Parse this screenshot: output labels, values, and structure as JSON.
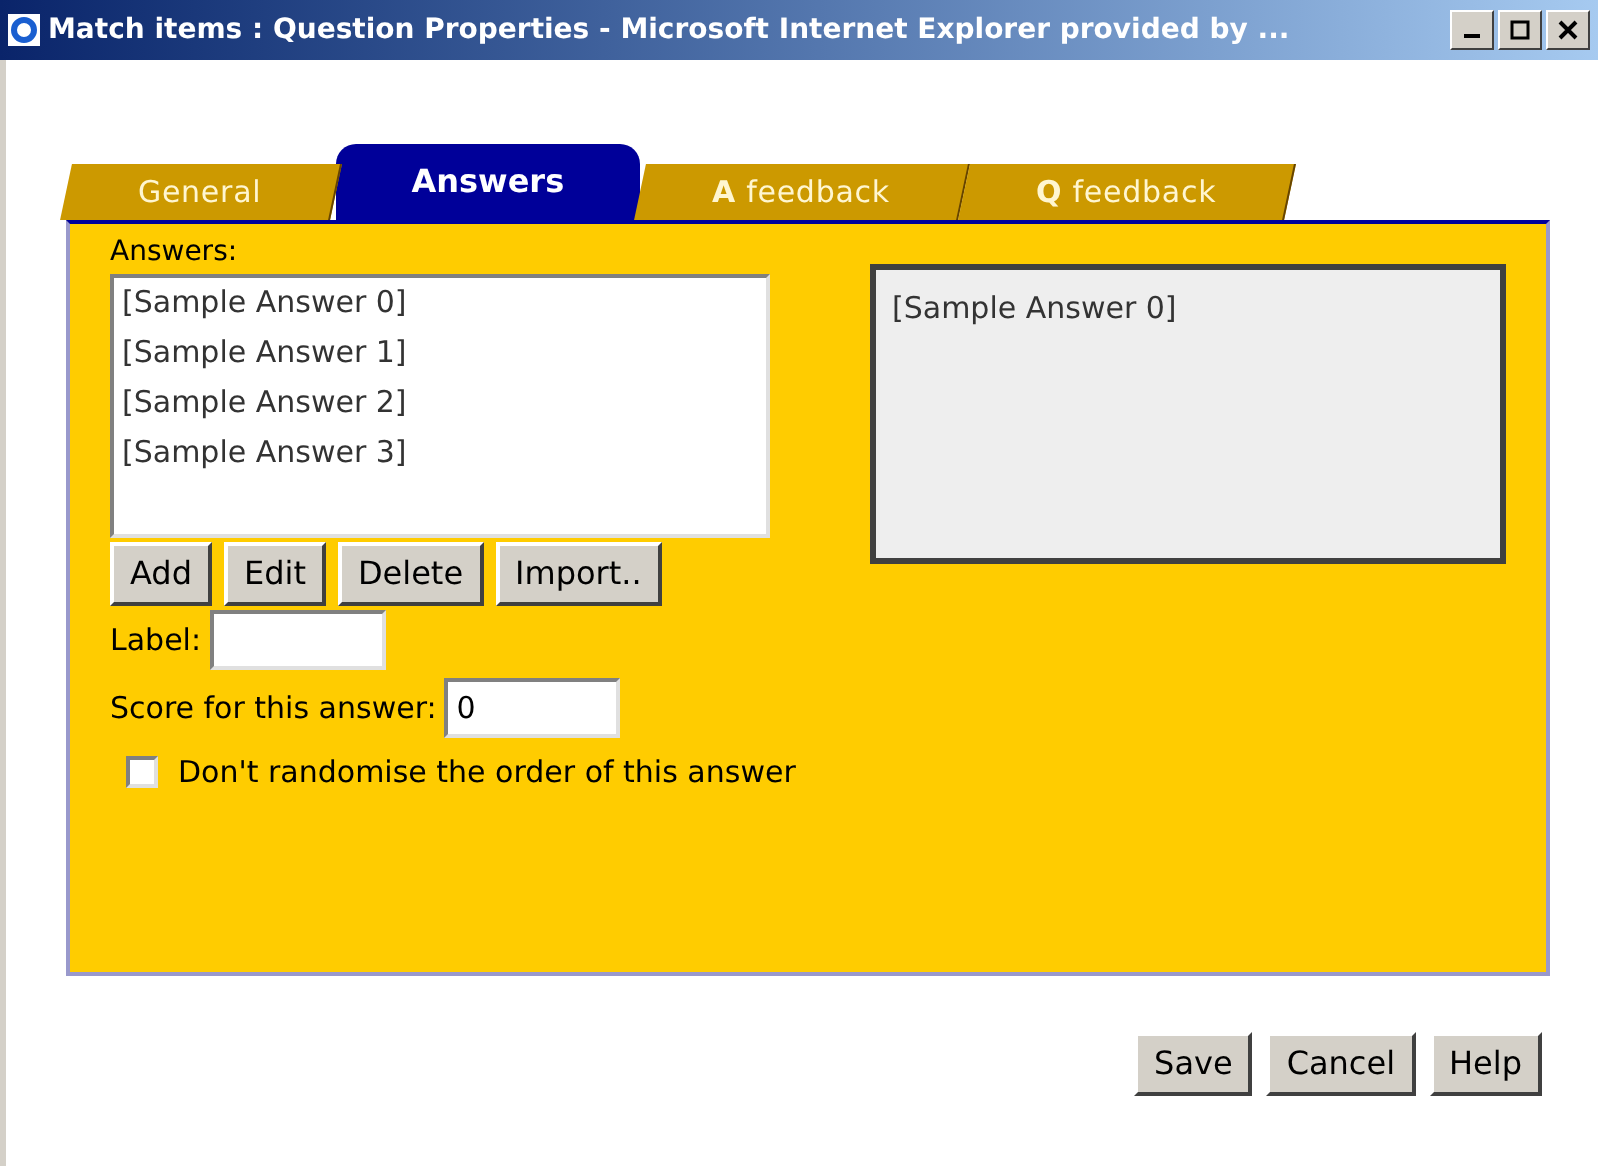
{
  "window": {
    "title": "Match items : Question Properties - Microsoft Internet Explorer provided by ..."
  },
  "tabs": [
    {
      "label": "General",
      "selected": false
    },
    {
      "label": "Answers",
      "selected": true
    },
    {
      "label": "**A** feedback",
      "selected": false
    },
    {
      "label": "**Q** feedback",
      "selected": false
    }
  ],
  "answers": {
    "label": "Answers:",
    "items": [
      "[Sample Answer 0]",
      "[Sample Answer 1]",
      "[Sample Answer 2]",
      "[Sample Answer 3]"
    ],
    "preview": "[Sample Answer 0]",
    "buttons": [
      "Add",
      "Edit",
      "Delete",
      "Import.."
    ]
  },
  "label_field": {
    "label": "Label:"
  },
  "score_field": {
    "label": "Score for this answer:",
    "value": "0"
  },
  "randomise": {
    "label": "Don't randomise the order of this answer",
    "checked": false
  },
  "buttons": [
    "Save",
    "Cancel",
    "Help"
  ]
}
